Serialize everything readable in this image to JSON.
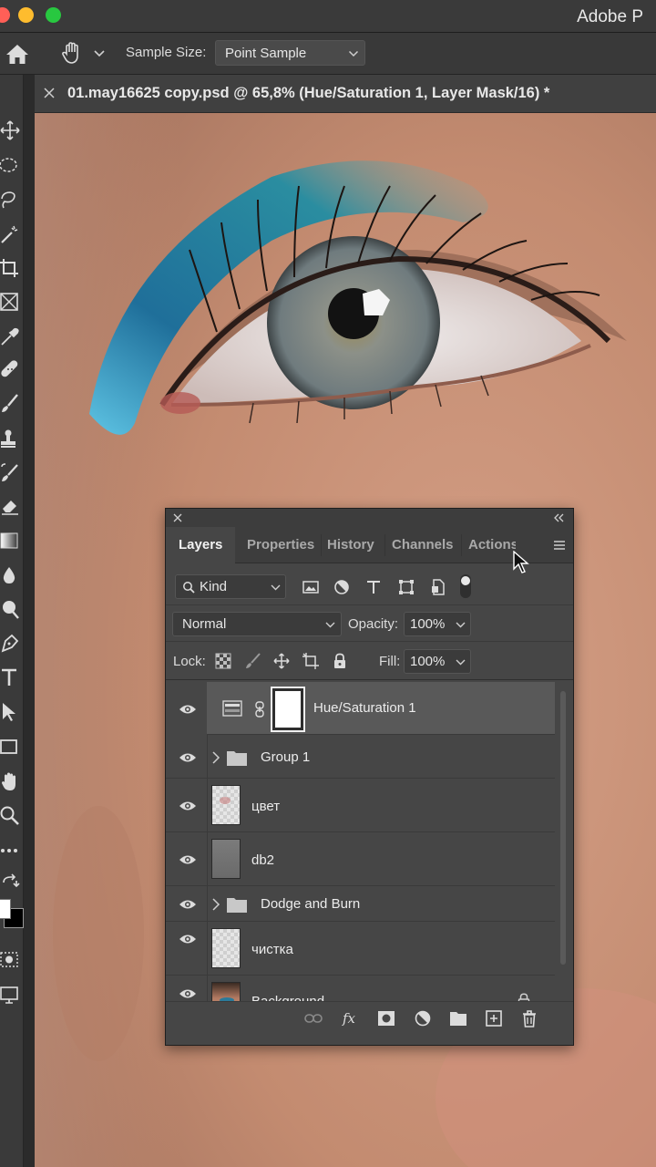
{
  "app": {
    "title": "Adobe P",
    "window_controls": [
      "close",
      "minimize",
      "maximize"
    ]
  },
  "options_bar": {
    "home_icon": "home-icon",
    "tool_icon": "hand-tool-icon",
    "sample_size_label": "Sample Size:",
    "sample_size_value": "Point Sample"
  },
  "toolbar": {
    "tools": [
      "move-icon",
      "marquee-icon",
      "lasso-icon",
      "magic-wand-icon",
      "crop-icon",
      "frame-icon",
      "eyedropper-icon",
      "healing-brush-icon",
      "brush-icon",
      "clone-stamp-icon",
      "history-brush-icon",
      "eraser-icon",
      "gradient-icon",
      "blur-icon",
      "dodge-icon",
      "pen-icon",
      "type-icon",
      "path-selection-icon",
      "rectangle-icon",
      "hand-icon",
      "zoom-icon",
      "more-tools-icon",
      "swap-colors-icon",
      "color-swatches-icon",
      "quick-mask-icon",
      "screen-mode-icon"
    ]
  },
  "document": {
    "tab_title": "01.may16625 copy.psd @ 65,8% (Hue/Saturation 1, Layer Mask/16) *"
  },
  "layers_panel": {
    "tabs": [
      {
        "label": "Layers",
        "active": true
      },
      {
        "label": "Properties",
        "active": false
      },
      {
        "label": "History",
        "active": false
      },
      {
        "label": "Channels",
        "active": false
      },
      {
        "label": "Actions",
        "active": false
      }
    ],
    "filter": {
      "kind_label": "Kind",
      "icons": [
        "pixel-layer-filter-icon",
        "adjustment-layer-filter-icon",
        "type-layer-filter-icon",
        "shape-layer-filter-icon",
        "smart-object-filter-icon",
        "filter-toggle-icon"
      ]
    },
    "blend_mode": "Normal",
    "opacity_label": "Opacity:",
    "opacity_value": "100%",
    "lock_label": "Lock:",
    "lock_icons": [
      "lock-transparent-pixels-icon",
      "lock-image-pixels-icon",
      "lock-position-icon",
      "lock-artboard-icon",
      "lock-all-icon"
    ],
    "fill_label": "Fill:",
    "fill_value": "100%",
    "layers": [
      {
        "name": "Hue/Saturation 1",
        "type": "adjustment",
        "selected": true,
        "visible": true
      },
      {
        "name": "Group 1",
        "type": "group",
        "selected": false,
        "visible": true
      },
      {
        "name": "цвет",
        "type": "pixel",
        "selected": false,
        "visible": true
      },
      {
        "name": "db2",
        "type": "pixel",
        "selected": false,
        "visible": true
      },
      {
        "name": "Dodge and Burn",
        "type": "group",
        "selected": false,
        "visible": true
      },
      {
        "name": "чистка",
        "type": "pixel",
        "selected": false,
        "visible": true
      },
      {
        "name": "Background",
        "type": "background",
        "selected": false,
        "visible": true,
        "locked": true
      }
    ],
    "footer_icons": [
      "link-layers-icon",
      "layer-style-fx-icon",
      "add-mask-icon",
      "new-adjustment-layer-icon",
      "new-group-icon",
      "new-layer-icon",
      "delete-layer-icon"
    ]
  },
  "colors": {
    "panel_bg": "#464646",
    "selected_row": "#595959",
    "toolbar_bg": "#3a3a3a",
    "eyeshadow_blue": "#1f6f9a"
  }
}
